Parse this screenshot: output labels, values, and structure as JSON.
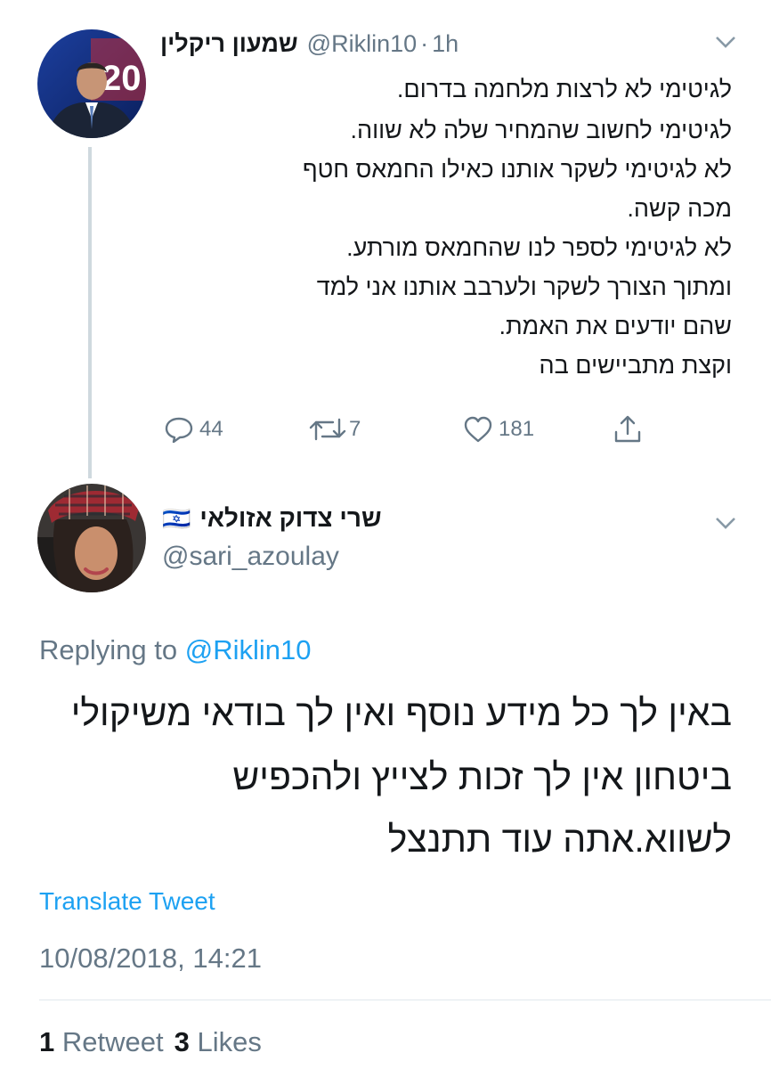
{
  "parent_tweet": {
    "author_name": "שמעון ריקלין",
    "handle": "@Riklin10",
    "separator": "·",
    "time_ago": "1h",
    "text_lines": [
      "לגיטימי לא לרצות מלחמה בדרום.",
      "לגיטימי לחשוב שהמחיר שלה לא שווה.",
      "לא לגיטימי לשקר אותנו כאילו החמאס חטף",
      "מכה קשה.",
      "לא לגיטימי לספר לנו שהחמאס מורתע.",
      "ומתוך הצורך לשקר ולערבב אותנו אני למד",
      "שהם יודעים את האמת.",
      "וקצת מתביישים בה"
    ],
    "reply_count": "44",
    "retweet_count": "7",
    "like_count": "181",
    "avatar_badge": "20"
  },
  "reply_tweet": {
    "author_name": "שרי צדוק אזולאי",
    "flag_emoji": "🇮🇱",
    "handle": "@sari_azoulay",
    "replying_to_label": "Replying to",
    "replying_to_handle": "@Riklin10",
    "text_lines": [
      "באין לך כל מידע נוסף ואין לך בודאי משיקולי",
      "ביטחון אין לך זכות לצייץ ולהכפיש",
      "לשווא.אתה עוד תתנצל"
    ],
    "translate_label": "Translate Tweet",
    "timestamp": "10/08/2018, 14:21",
    "retweets_count": "1",
    "retweets_label": "Retweet",
    "likes_count": "3",
    "likes_label": "Likes"
  },
  "colors": {
    "link": "#1da1f2",
    "muted": "#657786",
    "text": "#14171a",
    "thread_line": "#cfd9de"
  }
}
